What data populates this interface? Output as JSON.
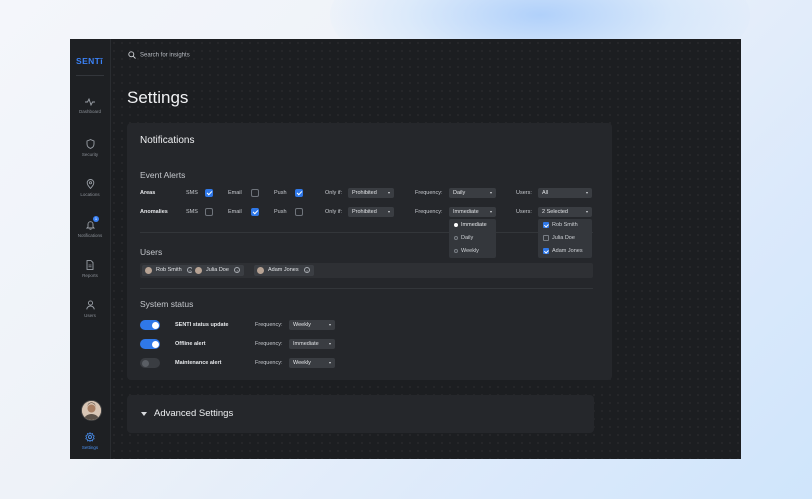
{
  "app": {
    "logo": "SENTī",
    "search_placeholder": "Search for insights",
    "page_title": "Settings"
  },
  "sidebar": {
    "items": [
      {
        "label": "Dashboard",
        "icon": "pulse-icon"
      },
      {
        "label": "Security",
        "icon": "shield-icon"
      },
      {
        "label": "Locations",
        "icon": "location-pin-icon"
      },
      {
        "label": "Notifications",
        "icon": "bell-icon",
        "badge": "1"
      },
      {
        "label": "Reports",
        "icon": "document-icon"
      },
      {
        "label": "Users",
        "icon": "user-icon"
      },
      {
        "label": "Settings",
        "icon": "gear-icon",
        "active": true
      }
    ]
  },
  "notifications": {
    "title": "Notifications",
    "event_alerts": {
      "heading": "Event Alerts",
      "sms_label": "SMS",
      "email_label": "Email",
      "push_label": "Push",
      "only_if_label": "Only if:",
      "frequency_label": "Frequency:",
      "users_label": "Users:",
      "rows": [
        {
          "name": "Areas",
          "sms": true,
          "email": false,
          "push": true,
          "only_if": "Prohibited",
          "frequency": "Daily",
          "users": "All"
        },
        {
          "name": "Anomalies",
          "sms": false,
          "email": true,
          "push": false,
          "only_if": "Prohibited",
          "frequency": "Immediate",
          "users": "2 Selected"
        }
      ],
      "frequency_menu": [
        {
          "label": "Immediate",
          "selected": true
        },
        {
          "label": "Daily",
          "selected": false
        },
        {
          "label": "Weekly",
          "selected": false
        }
      ],
      "users_menu": [
        {
          "label": "Rob Smith",
          "checked": true
        },
        {
          "label": "Julia Doe",
          "checked": false
        },
        {
          "label": "Adam Jones",
          "checked": true
        }
      ]
    },
    "users": {
      "heading": "Users",
      "chips": [
        "Rob Smith",
        "Julia Doe",
        "Adam Jones"
      ]
    },
    "system_status": {
      "heading": "System status",
      "frequency_label": "Frequency:",
      "rows": [
        {
          "name": "SENTI status update",
          "enabled": true,
          "frequency": "Weekly"
        },
        {
          "name": "Offline alert",
          "enabled": true,
          "frequency": "Immediate"
        },
        {
          "name": "Maintenance alert",
          "enabled": false,
          "frequency": "Weekly"
        }
      ]
    }
  },
  "advanced": {
    "title": "Advanced Settings"
  },
  "colors": {
    "accent": "#2f78e8",
    "background": "#1c1e21",
    "card": "#25272b"
  }
}
